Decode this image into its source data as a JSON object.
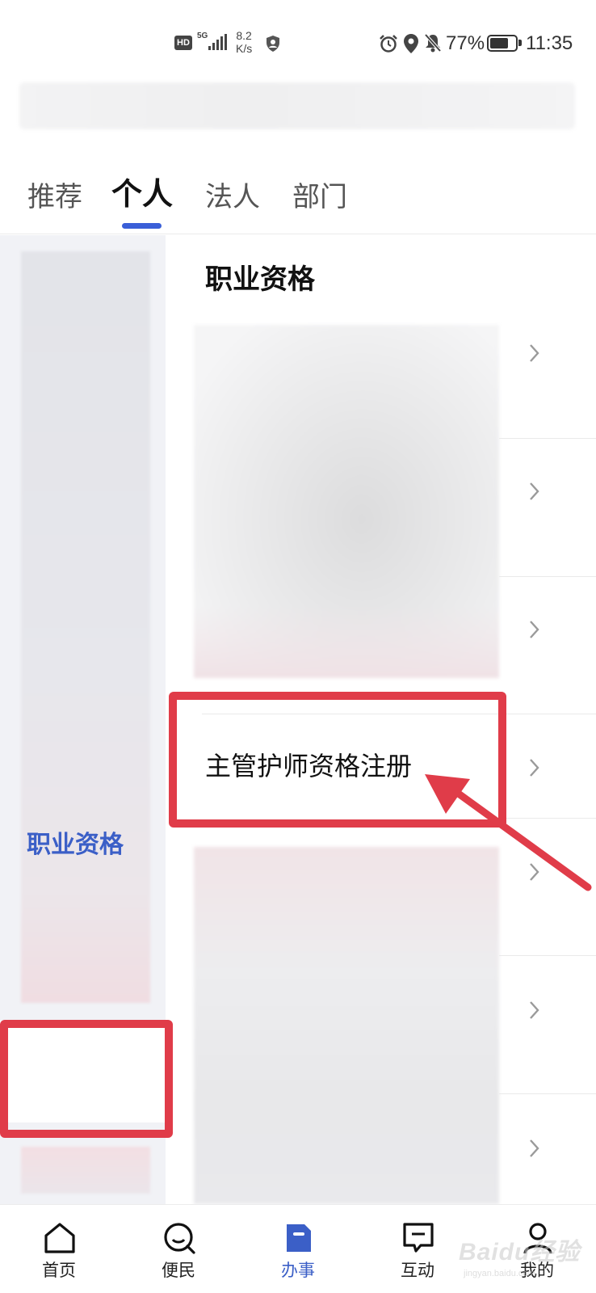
{
  "status_bar": {
    "hd": "HD",
    "network": "5G",
    "speed_value": "8.2",
    "speed_unit": "K/s",
    "battery": "77%",
    "battery_level": 0.77,
    "time": "11:35",
    "icons": [
      "hd-icon",
      "signal-icon",
      "shield-icon",
      "alarm-icon",
      "location-icon",
      "mute-bell-icon",
      "battery-icon"
    ]
  },
  "tabs": [
    {
      "label": "推荐",
      "active": false
    },
    {
      "label": "个人",
      "active": true
    },
    {
      "label": "法人",
      "active": false
    },
    {
      "label": "部门",
      "active": false
    }
  ],
  "sidebar": {
    "active_label": "职业资格"
  },
  "content": {
    "section_title": "职业资格",
    "highlighted_item": "主管护师资格注册"
  },
  "annotation": {
    "color": "#e03c49"
  },
  "bottom_nav": [
    {
      "label": "首页",
      "icon": "home-icon",
      "active": false
    },
    {
      "label": "便民",
      "icon": "chat-search-icon",
      "active": false
    },
    {
      "label": "办事",
      "icon": "document-icon",
      "active": true
    },
    {
      "label": "互动",
      "icon": "message-icon",
      "active": false
    },
    {
      "label": "我的",
      "icon": "user-icon",
      "active": false
    }
  ],
  "watermark": {
    "brand": "Baidu经验",
    "url": "jingyan.baidu.com"
  },
  "colors": {
    "accent": "#3b5fc7",
    "tab_indicator": "#3a5fd8",
    "sidebar_bg": "#f1f2f6"
  }
}
